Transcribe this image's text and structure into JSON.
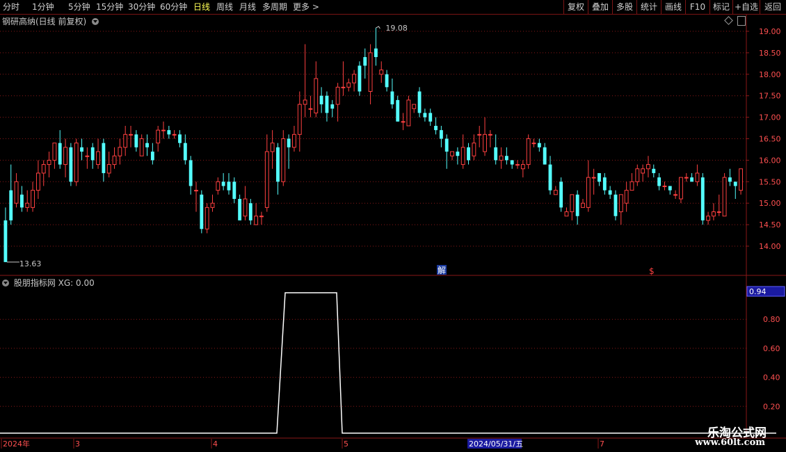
{
  "toolbar": {
    "timeframes": [
      "分时",
      "1分钟",
      "5分钟",
      "15分钟",
      "30分钟",
      "60分钟",
      "日线",
      "周线",
      "月线",
      "多周期",
      "更多 >"
    ],
    "active_timeframe": "日线",
    "buttons": [
      "复权",
      "叠加",
      "多股",
      "统计",
      "画线",
      "F10",
      "标记",
      "+自选",
      "返回"
    ]
  },
  "main_chart": {
    "title": "钢研高纳(日线 前复权)",
    "high_label": "19.08",
    "low_label": "13.63",
    "markers": [
      "解",
      "$"
    ],
    "y_ticks": [
      "19.00",
      "18.50",
      "18.00",
      "17.50",
      "17.00",
      "16.50",
      "16.00",
      "15.50",
      "15.00",
      "14.50",
      "14.00"
    ],
    "settings_icon": "diamond-icon",
    "scroll_icon": "scrollbar-icon"
  },
  "indicator": {
    "title": "股朋指标网 XG: 0.00",
    "current_value": "0.94",
    "y_ticks": [
      "0.80",
      "0.60",
      "0.40",
      "0.20"
    ]
  },
  "time_axis": {
    "labels": [
      "2024年",
      "3",
      "4",
      "5",
      "7"
    ],
    "cursor_date": "2024/05/31/五"
  },
  "watermark": {
    "name": "乐淘公式网",
    "url": "www.60lt.com"
  },
  "colors": {
    "up": "#ff4040",
    "down": "#54ffff",
    "grid": "#8a1818",
    "line": "#ffffff"
  },
  "chart_data": [
    {
      "type": "candlestick",
      "title": "钢研高纳(日线 前复权)",
      "ylim": [
        13.6,
        19.1
      ],
      "y_ticks": [
        14.0,
        14.5,
        15.0,
        15.5,
        16.0,
        16.5,
        17.0,
        17.5,
        18.0,
        18.5,
        19.0
      ],
      "x_labels": [
        "2024年",
        "3",
        "4",
        "5",
        "7"
      ],
      "annotations": {
        "high": 19.08,
        "low": 13.63
      },
      "candles": [
        [
          14.6,
          13.63,
          14.9,
          13.63
        ],
        [
          15.3,
          14.6,
          15.9,
          14.5
        ],
        [
          15.0,
          15.5,
          15.7,
          14.9
        ],
        [
          15.2,
          14.9,
          15.4,
          14.8
        ],
        [
          14.9,
          15.0,
          15.3,
          14.8
        ],
        [
          14.9,
          15.3,
          15.5,
          14.8
        ],
        [
          15.3,
          15.7,
          16.0,
          15.1
        ],
        [
          15.7,
          15.9,
          16.0,
          15.4
        ],
        [
          15.9,
          16.0,
          16.2,
          15.6
        ],
        [
          16.0,
          16.4,
          16.4,
          15.8
        ],
        [
          16.4,
          15.9,
          16.7,
          15.8
        ],
        [
          15.9,
          16.3,
          16.5,
          15.6
        ],
        [
          16.3,
          15.5,
          16.4,
          15.4
        ],
        [
          15.5,
          16.4,
          16.5,
          15.4
        ],
        [
          16.3,
          16.2,
          16.5,
          16.0
        ],
        [
          16.1,
          16.1,
          16.3,
          15.8
        ],
        [
          16.3,
          16.0,
          16.4,
          15.8
        ],
        [
          15.9,
          16.2,
          16.5,
          15.8
        ],
        [
          16.4,
          15.7,
          16.5,
          15.5
        ],
        [
          15.7,
          15.9,
          16.2,
          15.6
        ],
        [
          15.9,
          16.1,
          16.3,
          15.8
        ],
        [
          16.1,
          16.3,
          16.5,
          15.9
        ],
        [
          16.3,
          16.6,
          16.8,
          16.1
        ],
        [
          16.6,
          16.6,
          16.8,
          16.3
        ],
        [
          16.6,
          16.3,
          16.7,
          16.2
        ],
        [
          16.1,
          16.5,
          16.6,
          16.1
        ],
        [
          16.4,
          16.3,
          16.6,
          16.1
        ],
        [
          16.2,
          16.0,
          16.4,
          15.9
        ],
        [
          16.4,
          16.7,
          16.8,
          16.2
        ],
        [
          16.7,
          16.7,
          16.9,
          16.5
        ],
        [
          16.7,
          16.6,
          16.8,
          16.5
        ],
        [
          16.6,
          16.6,
          16.7,
          16.5
        ],
        [
          16.6,
          16.4,
          16.7,
          16.3
        ],
        [
          16.4,
          16.0,
          16.6,
          15.9
        ],
        [
          16.0,
          15.4,
          16.1,
          15.2
        ],
        [
          15.3,
          15.3,
          15.5,
          14.8
        ],
        [
          15.2,
          14.4,
          15.3,
          14.3
        ],
        [
          14.4,
          14.9,
          15.0,
          14.3
        ],
        [
          14.9,
          15.0,
          15.2,
          14.8
        ],
        [
          15.3,
          15.5,
          15.6,
          15.2
        ],
        [
          15.5,
          15.4,
          15.7,
          15.3
        ],
        [
          15.5,
          15.3,
          15.7,
          15.2
        ],
        [
          15.5,
          15.1,
          15.6,
          15.0
        ],
        [
          15.1,
          14.6,
          15.2,
          14.6
        ],
        [
          14.7,
          15.1,
          15.4,
          14.6
        ],
        [
          15.0,
          14.6,
          15.1,
          14.5
        ],
        [
          14.5,
          14.7,
          15.0,
          14.5
        ],
        [
          14.7,
          14.7,
          14.8,
          14.5
        ],
        [
          14.9,
          16.2,
          16.6,
          14.8
        ],
        [
          16.2,
          16.4,
          16.7,
          15.8
        ],
        [
          16.3,
          15.5,
          16.4,
          15.2
        ],
        [
          15.5,
          16.5,
          16.7,
          15.4
        ],
        [
          16.5,
          16.3,
          16.6,
          15.8
        ],
        [
          16.3,
          16.6,
          16.8,
          16.2
        ],
        [
          16.6,
          17.3,
          17.6,
          16.2
        ],
        [
          17.3,
          17.4,
          18.7,
          17.0
        ],
        [
          17.2,
          17.2,
          17.5,
          17.0
        ],
        [
          17.1,
          17.9,
          18.3,
          17.0
        ],
        [
          17.5,
          17.3,
          17.7,
          17.1
        ],
        [
          17.5,
          17.1,
          17.6,
          16.9
        ],
        [
          17.3,
          17.2,
          17.4,
          17.0
        ],
        [
          17.3,
          17.7,
          17.8,
          16.9
        ],
        [
          17.7,
          17.7,
          18.3,
          17.5
        ],
        [
          17.7,
          17.8,
          17.9,
          17.6
        ],
        [
          17.8,
          18.0,
          18.1,
          17.6
        ],
        [
          18.2,
          17.6,
          18.3,
          17.5
        ],
        [
          18.4,
          18.2,
          18.6,
          17.9
        ],
        [
          17.6,
          18.5,
          18.7,
          17.3
        ],
        [
          18.6,
          18.4,
          19.08,
          18.2
        ],
        [
          18.0,
          18.1,
          18.3,
          17.8
        ],
        [
          18.0,
          17.7,
          18.1,
          17.6
        ],
        [
          17.6,
          17.3,
          17.9,
          17.2
        ],
        [
          17.4,
          16.9,
          17.5,
          16.9
        ],
        [
          16.9,
          16.9,
          17.1,
          16.7
        ],
        [
          16.8,
          17.4,
          17.5,
          16.8
        ],
        [
          17.2,
          17.3,
          17.3,
          17.1
        ],
        [
          17.6,
          17.1,
          17.7,
          17.0
        ],
        [
          17.1,
          17.0,
          17.2,
          16.9
        ],
        [
          17.1,
          16.9,
          17.2,
          16.8
        ],
        [
          16.8,
          16.7,
          17.0,
          16.6
        ],
        [
          16.7,
          16.5,
          16.8,
          16.3
        ],
        [
          16.5,
          16.2,
          16.6,
          15.8
        ],
        [
          16.1,
          16.2,
          16.2,
          16.0
        ],
        [
          16.2,
          16.1,
          16.3,
          15.9
        ],
        [
          15.9,
          16.3,
          16.6,
          15.8
        ],
        [
          16.3,
          16.0,
          16.4,
          15.9
        ],
        [
          16.1,
          16.4,
          16.6,
          16.0
        ],
        [
          16.6,
          16.6,
          16.8,
          16.3
        ],
        [
          16.2,
          16.6,
          17.0,
          16.1
        ],
        [
          16.6,
          16.6,
          16.7,
          16.3
        ],
        [
          16.3,
          16.0,
          16.6,
          15.9
        ],
        [
          16.0,
          16.1,
          16.3,
          15.8
        ],
        [
          16.1,
          16.0,
          16.3,
          15.9
        ],
        [
          16.0,
          15.9,
          16.0,
          15.8
        ],
        [
          15.9,
          15.9,
          16.0,
          15.8
        ],
        [
          15.8,
          15.9,
          16.0,
          15.6
        ],
        [
          15.9,
          16.5,
          16.6,
          15.8
        ],
        [
          16.4,
          16.4,
          16.5,
          16.3
        ],
        [
          16.4,
          16.3,
          16.5,
          16.2
        ],
        [
          16.3,
          15.9,
          16.4,
          15.9
        ],
        [
          15.9,
          15.3,
          16.1,
          15.2
        ],
        [
          15.2,
          15.3,
          15.4,
          15.2
        ],
        [
          15.5,
          14.9,
          15.6,
          14.8
        ],
        [
          14.7,
          14.8,
          14.9,
          14.7
        ],
        [
          14.8,
          15.2,
          15.2,
          14.6
        ],
        [
          15.2,
          14.7,
          15.3,
          14.5
        ],
        [
          14.9,
          15.0,
          15.1,
          14.9
        ],
        [
          14.9,
          15.6,
          16.0,
          14.8
        ],
        [
          15.6,
          15.6,
          15.8,
          15.2
        ],
        [
          15.7,
          15.5,
          15.7,
          15.4
        ],
        [
          15.6,
          15.3,
          15.7,
          15.2
        ],
        [
          15.3,
          15.2,
          15.4,
          15.1
        ],
        [
          15.2,
          14.7,
          15.3,
          14.6
        ],
        [
          14.8,
          15.2,
          15.2,
          14.5
        ],
        [
          15.0,
          15.3,
          15.5,
          14.8
        ],
        [
          15.3,
          15.5,
          15.7,
          15.3
        ],
        [
          15.5,
          15.8,
          15.9,
          15.4
        ],
        [
          15.7,
          15.8,
          15.9,
          15.5
        ],
        [
          15.8,
          15.9,
          16.1,
          15.6
        ],
        [
          15.8,
          15.7,
          15.9,
          15.6
        ],
        [
          15.6,
          15.4,
          15.7,
          15.3
        ],
        [
          15.4,
          15.4,
          15.5,
          15.3
        ],
        [
          15.4,
          15.3,
          15.4,
          15.2
        ],
        [
          15.2,
          15.2,
          15.3,
          15.1
        ],
        [
          15.1,
          15.6,
          15.6,
          15.0
        ],
        [
          15.6,
          15.6,
          15.7,
          15.5
        ],
        [
          15.6,
          15.5,
          15.7,
          15.5
        ],
        [
          15.5,
          15.7,
          15.9,
          15.4
        ],
        [
          15.6,
          14.6,
          15.7,
          14.5
        ],
        [
          14.6,
          14.7,
          14.8,
          14.5
        ],
        [
          14.7,
          14.8,
          15.0,
          14.6
        ],
        [
          14.8,
          14.8,
          15.2,
          14.7
        ],
        [
          14.7,
          15.6,
          15.7,
          14.7
        ],
        [
          15.6,
          15.5,
          15.8,
          15.4
        ],
        [
          15.5,
          15.4,
          15.5,
          15.1
        ],
        [
          15.3,
          15.8,
          15.8,
          15.2
        ]
      ]
    },
    {
      "type": "line",
      "title": "股朋指标网",
      "series": [
        {
          "name": "XG",
          "x": [
            0,
            398,
            410,
            484,
            492,
            1116
          ],
          "values": [
            0,
            0,
            1,
            1,
            0,
            0
          ]
        }
      ],
      "ylim": [
        0,
        1
      ]
    }
  ]
}
